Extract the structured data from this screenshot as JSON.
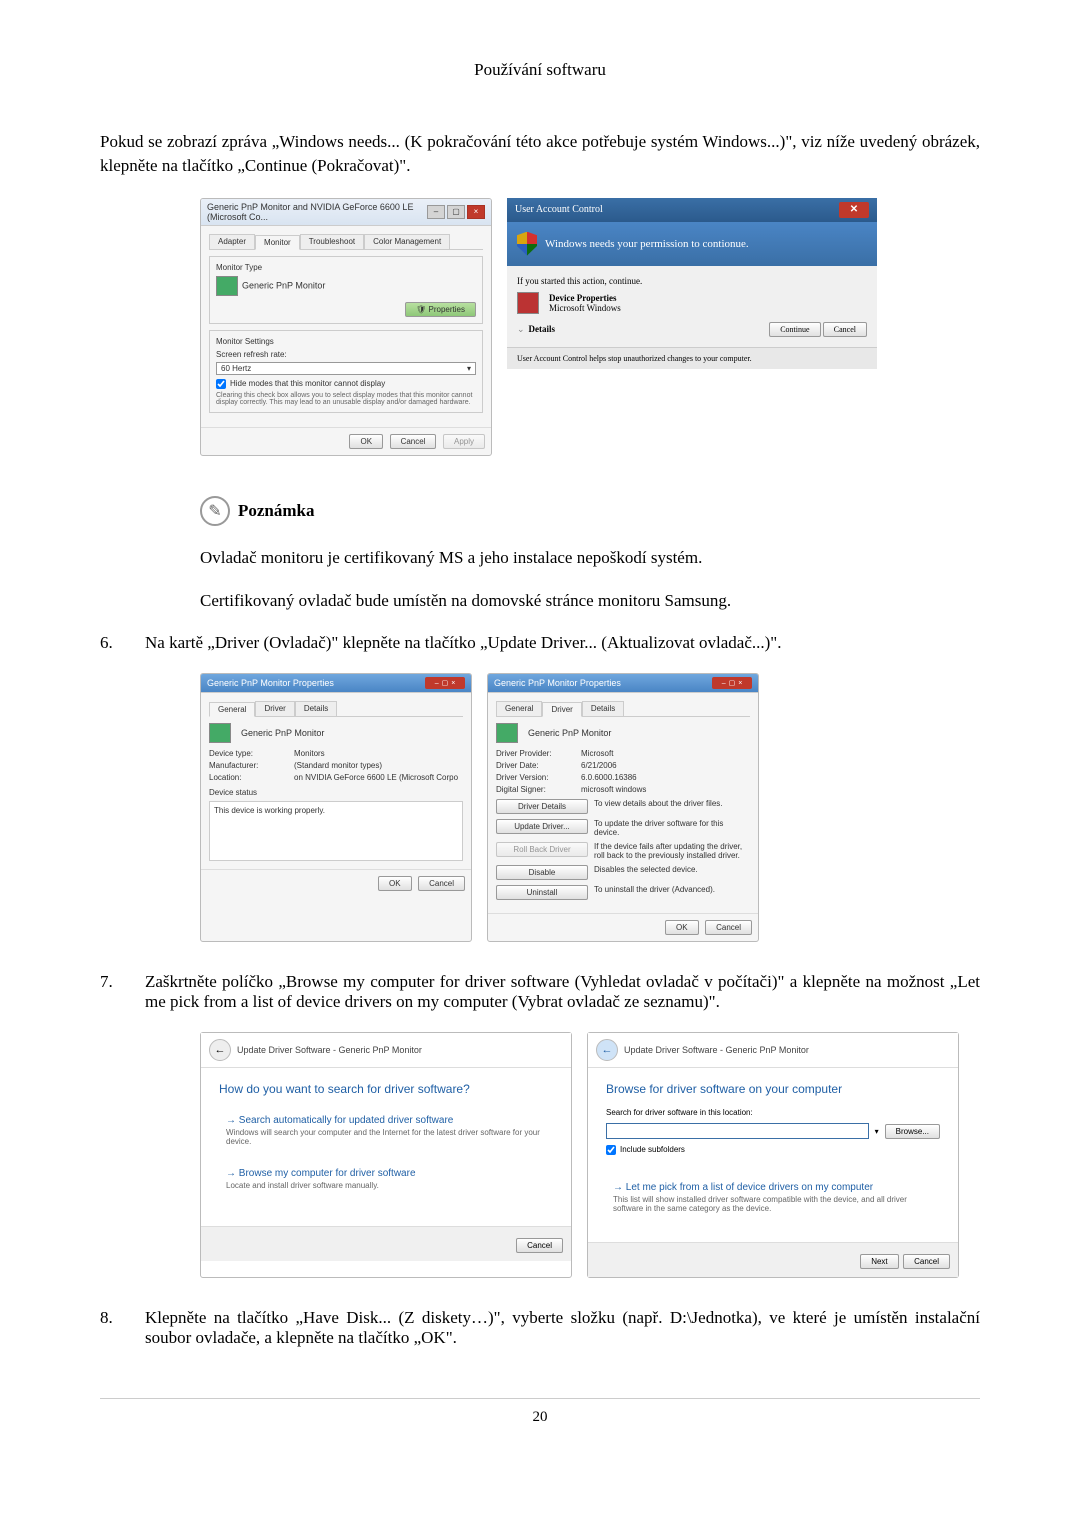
{
  "header": "Používání softwaru",
  "intro": "Pokud se zobrazí zpráva „Windows needs... (K pokračování této akce potřebuje systém Windows...)\", viz níže uvedený obrázek, klepněte na tlačítko „Continue (Pokračovat)\".",
  "dlg1": {
    "title": "Generic PnP Monitor and NVIDIA GeForce 6600 LE (Microsoft Co...",
    "tabAdapter": "Adapter",
    "tabMonitor": "Monitor",
    "tabTrouble": "Troubleshoot",
    "tabColor": "Color Management",
    "monitorTypeLabel": "Monitor Type",
    "monitorType": "Generic PnP Monitor",
    "propertiesBtn": "Properties",
    "settingsLabel": "Monitor Settings",
    "refreshLabel": "Screen refresh rate:",
    "refreshValue": "60 Hertz",
    "hideModes": "Hide modes that this monitor cannot display",
    "hideDesc": "Clearing this check box allows you to select display modes that this monitor cannot display correctly. This may lead to an unusable display and/or damaged hardware.",
    "ok": "OK",
    "cancel": "Cancel",
    "apply": "Apply"
  },
  "uac": {
    "title": "User Account Control",
    "banner": "Windows needs your permission to contionue.",
    "started": "If you started this action, continue.",
    "app": "Device Properties",
    "pub": "Microsoft Windows",
    "details": "Details",
    "cont": "Continue",
    "cancel": "Cancel",
    "footer": "User Account Control helps stop unauthorized changes to your computer."
  },
  "note": {
    "label": "Poznámka"
  },
  "noteP1": "Ovladač monitoru je certifikovaný MS a jeho instalace nepoškodí systém.",
  "noteP2": "Certifikovaný ovladač bude umístěn na domovské stránce monitoru Samsung.",
  "step6": {
    "num": "6.",
    "text": "Na kartě „Driver (Ovladač)\" klepněte na tlačítko „Update Driver... (Aktualizovat ovladač...)\"."
  },
  "props1": {
    "title": "Generic PnP Monitor Properties",
    "tabGeneral": "General",
    "tabDriver": "Driver",
    "tabDetails": "Details",
    "name": "Generic PnP Monitor",
    "devtypeK": "Device type:",
    "devtypeV": "Monitors",
    "mfgK": "Manufacturer:",
    "mfgV": "(Standard monitor types)",
    "locK": "Location:",
    "locV": "on NVIDIA GeForce 6600 LE (Microsoft Corpo",
    "statusLabel": "Device status",
    "statusText": "This device is working properly.",
    "ok": "OK",
    "cancel": "Cancel"
  },
  "props2": {
    "title": "Generic PnP Monitor Properties",
    "tabGeneral": "General",
    "tabDriver": "Driver",
    "tabDetails": "Details",
    "name": "Generic PnP Monitor",
    "provK": "Driver Provider:",
    "provV": "Microsoft",
    "dateK": "Driver Date:",
    "dateV": "6/21/2006",
    "verK": "Driver Version:",
    "verV": "6.0.6000.16386",
    "signK": "Digital Signer:",
    "signV": "microsoft windows",
    "btnDetails": "Driver Details",
    "descDetails": "To view details about the driver files.",
    "btnUpdate": "Update Driver...",
    "descUpdate": "To update the driver software for this device.",
    "btnRoll": "Roll Back Driver",
    "descRoll": "If the device fails after updating the driver, roll back to the previously installed driver.",
    "btnDisable": "Disable",
    "descDisable": "Disables the selected device.",
    "btnUninstall": "Uninstall",
    "descUninstall": "To uninstall the driver (Advanced).",
    "ok": "OK",
    "cancel": "Cancel"
  },
  "step7": {
    "num": "7.",
    "text": "Zaškrtněte políčko „Browse my computer for driver software (Vyhledat ovladač v počítači)\" a klepněte na možnost „Let me pick from a list of device drivers on my computer (Vybrat ovladač ze seznamu)\"."
  },
  "wiz1": {
    "bc": "Update Driver Software - Generic PnP Monitor",
    "heading": "How do you want to search for driver software?",
    "opt1t": "Search automatically for updated driver software",
    "opt1d": "Windows will search your computer and the Internet for the latest driver software for your device.",
    "opt2t": "Browse my computer for driver software",
    "opt2d": "Locate and install driver software manually.",
    "cancel": "Cancel"
  },
  "wiz2": {
    "bc": "Update Driver Software - Generic PnP Monitor",
    "heading": "Browse for driver software on your computer",
    "locLabel": "Search for driver software in this location:",
    "browse": "Browse...",
    "include": "Include subfolders",
    "pick": "Let me pick from a list of device drivers on my computer",
    "pickd": "This list will show installed driver software compatible with the device, and all driver software in the same category as the device.",
    "next": "Next",
    "cancel": "Cancel"
  },
  "step8": {
    "num": "8.",
    "text": "Klepněte na tlačítko „Have Disk... (Z diskety…)\", vyberte složku (např. D:\\Jednotka), ve které je umístěn instalační soubor ovladače, a klepněte na tlačítko „OK\"."
  },
  "pageNumber": "20"
}
